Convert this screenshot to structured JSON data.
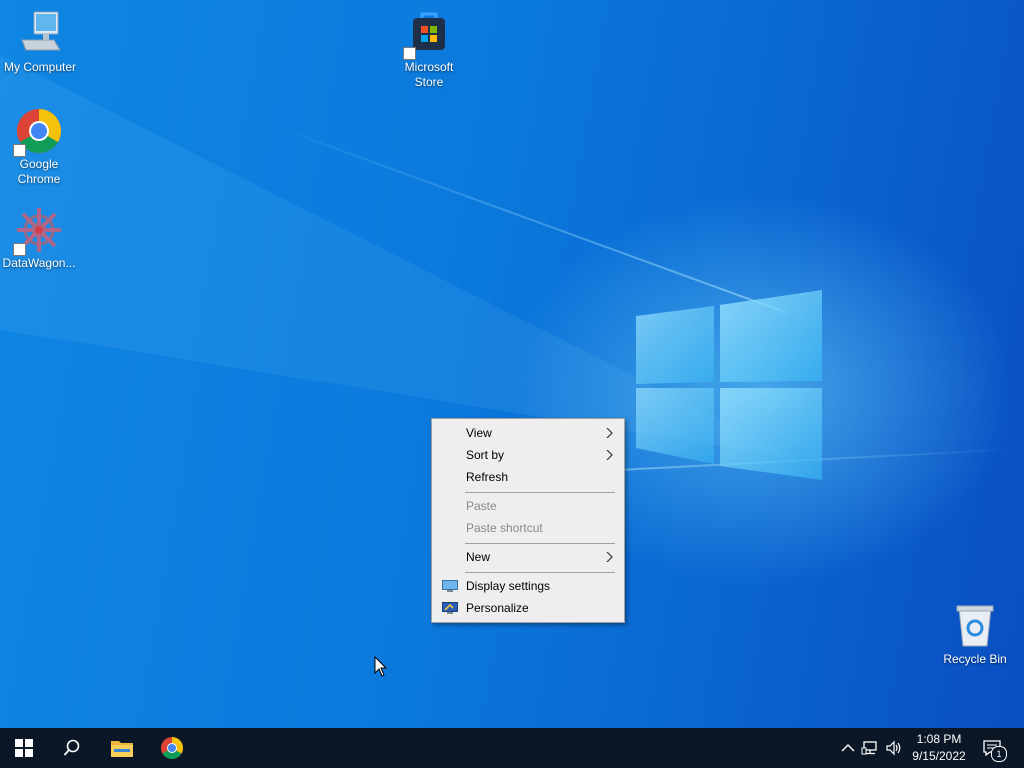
{
  "desktop": {
    "icons": [
      {
        "label": "My Computer"
      },
      {
        "label": "Google Chrome"
      },
      {
        "label": "DataWagon..."
      },
      {
        "label": "Microsoft Store"
      },
      {
        "label": "Recycle Bin"
      }
    ]
  },
  "context_menu": {
    "items": [
      {
        "label": "View",
        "submenu": true,
        "enabled": true
      },
      {
        "label": "Sort by",
        "submenu": true,
        "enabled": true
      },
      {
        "label": "Refresh",
        "submenu": false,
        "enabled": true
      },
      {
        "label": "Paste",
        "submenu": false,
        "enabled": false
      },
      {
        "label": "Paste shortcut",
        "submenu": false,
        "enabled": false
      },
      {
        "label": "New",
        "submenu": true,
        "enabled": true
      },
      {
        "label": "Display settings",
        "icon": "display-icon",
        "enabled": true
      },
      {
        "label": "Personalize",
        "icon": "personalize-icon",
        "enabled": true
      }
    ]
  },
  "taskbar": {
    "buttons": [
      {
        "icon": "windows-start-icon"
      },
      {
        "icon": "search-icon"
      },
      {
        "icon": "file-explorer-icon"
      },
      {
        "icon": "chrome-icon"
      }
    ],
    "tray": {
      "icons": [
        "chevron-up-icon",
        "network-icon",
        "volume-icon"
      ],
      "time": "1:08 PM",
      "date": "9/15/2022",
      "notification_count": "1"
    }
  },
  "colors": {
    "desktop_blue": "#0b79dc",
    "taskbar": "#0b1726",
    "menu_bg": "#eeeeee"
  }
}
